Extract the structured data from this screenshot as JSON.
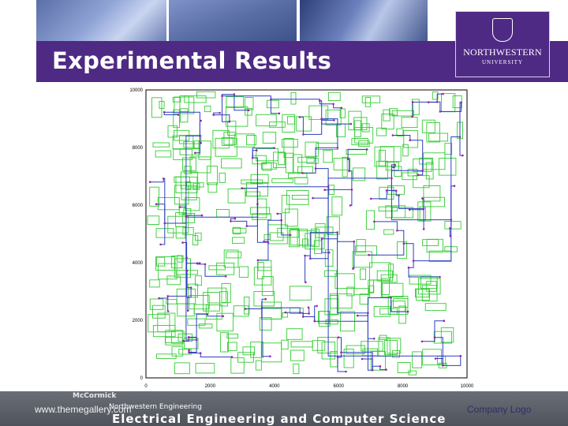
{
  "slide": {
    "title": "Experimental Results",
    "footer_url": "www.themegallery.com",
    "footer_logo": "Company Logo"
  },
  "university_logo": {
    "name": "NORTHWESTERN",
    "subtitle": "UNIVERSITY",
    "icon": "university-seal-icon"
  },
  "banner": {
    "line1": "McCormick",
    "line2": "Northwestern Engineering",
    "line3": "Electrical Engineering and Computer Science"
  },
  "chart_data": {
    "type": "scatter",
    "xlim": [
      0,
      10000
    ],
    "ylim": [
      0,
      10000
    ],
    "xticks": [
      "0",
      "2000",
      "4000",
      "6000",
      "8000",
      "10000"
    ],
    "yticks": [
      "0",
      "2000",
      "4000",
      "6000",
      "8000",
      "10000"
    ],
    "series_colors": {
      "obstacles": "#33cc33",
      "routes": "#2a3fbf",
      "pins": "#a020a0"
    }
  }
}
